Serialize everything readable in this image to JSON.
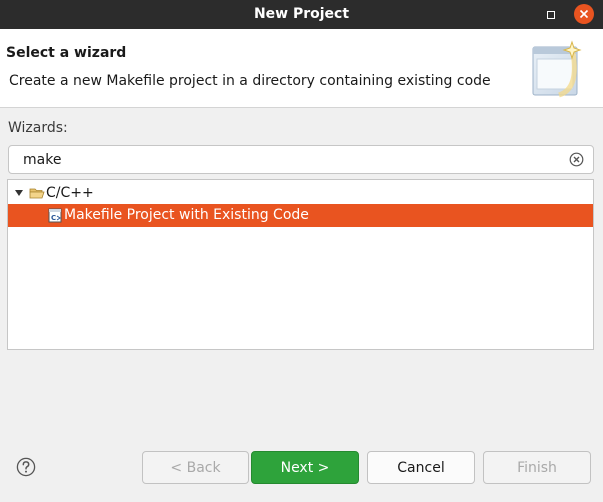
{
  "window": {
    "title": "New Project"
  },
  "banner": {
    "heading": "Select a wizard",
    "description": "Create a new Makefile project in a directory containing existing code"
  },
  "wizards": {
    "label": "Wizards:",
    "search_value": "make",
    "tree": [
      {
        "label": "C/C++",
        "expanded": true,
        "icon": "folder-open-icon"
      },
      {
        "label": "Makefile Project with Existing Code",
        "selected": true,
        "icon": "c-project-file-icon"
      }
    ]
  },
  "buttons": {
    "back": "< Back",
    "next": "Next >",
    "cancel": "Cancel",
    "finish": "Finish"
  },
  "colors": {
    "accent": "#e95420",
    "primary_button": "#2ea33b",
    "titlebar": "#2c2c2c"
  }
}
